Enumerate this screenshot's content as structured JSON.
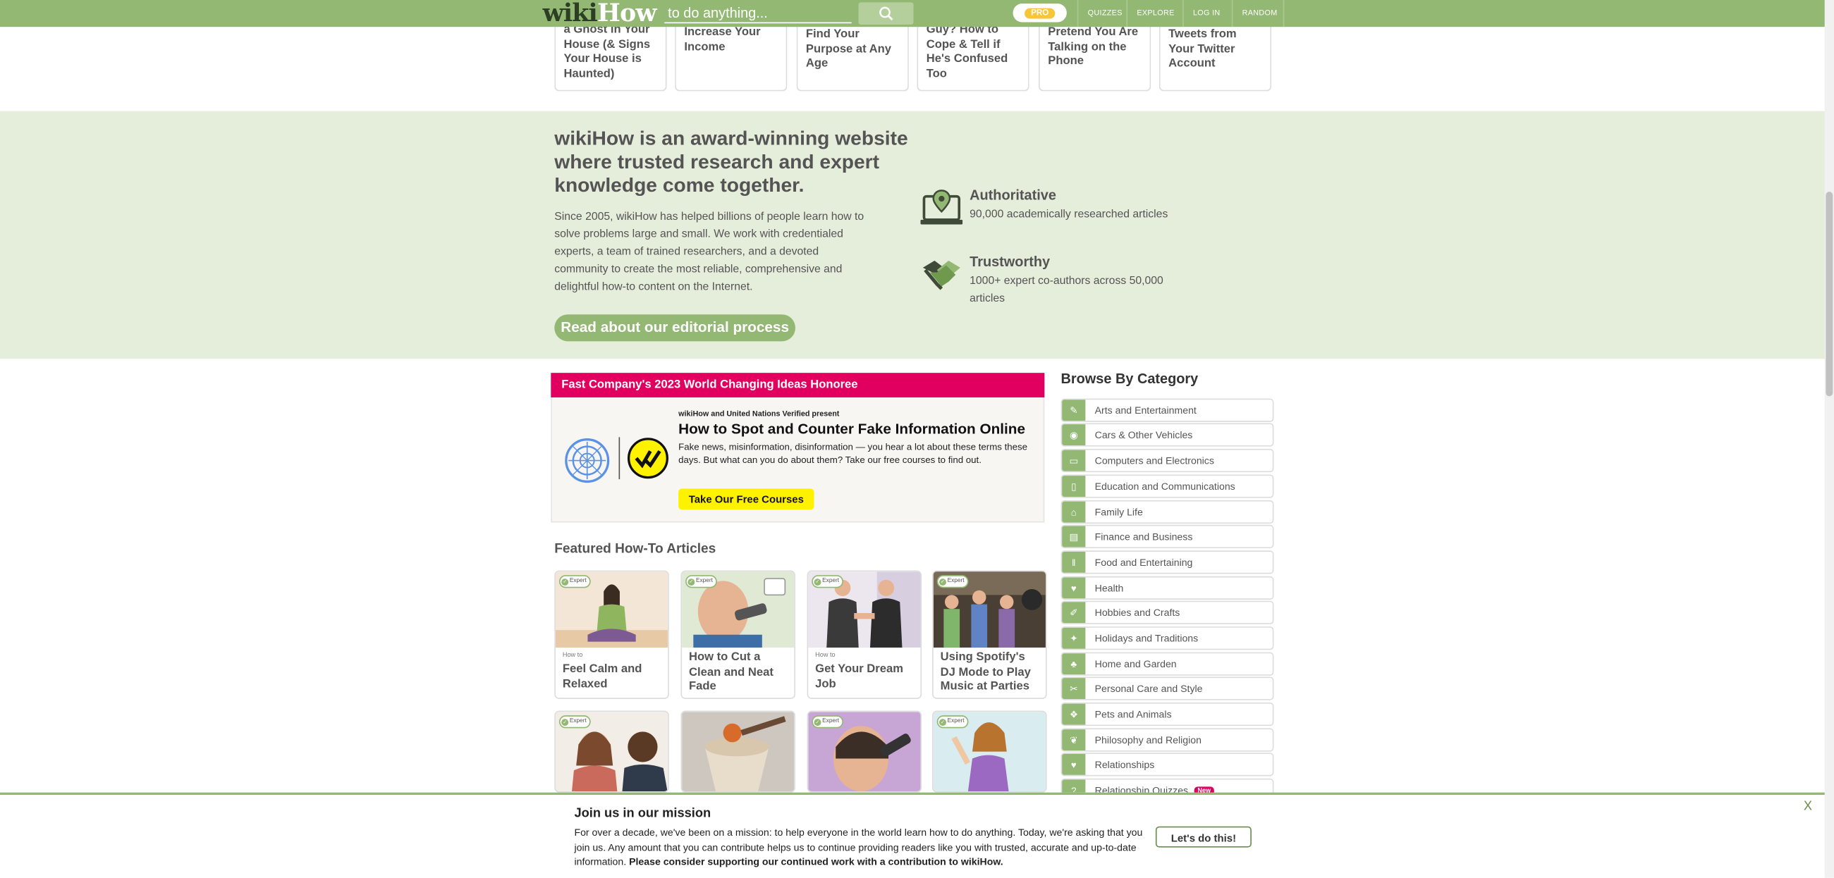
{
  "header": {
    "logo_part1": "wiki",
    "logo_part2": "How",
    "search_placeholder": "to do anything...",
    "pro_label": "PRO",
    "nav": [
      "QUIZZES",
      "EXPLORE",
      "LOG IN",
      "RANDOM"
    ]
  },
  "related_cards": [
    "a Ghost in Your House (& Signs Your House is Haunted)",
    "Increase Your Income",
    "Find Your Purpose at Any Age",
    "Guy? How to Cope & Tell if He's Confused Too",
    "Pretend You Are Talking on the Phone",
    "Tweets from Your Twitter Account"
  ],
  "award": {
    "heading": "wikiHow is an award-winning website where trusted research and expert knowledge come together.",
    "body": "Since 2005, wikiHow has helped billions of people learn how to solve problems large and small. We work with credentialed experts, a team of trained researchers, and a devoted community to create the most reliable, comprehensive and delightful how-to content on the Internet.",
    "button": "Read about our editorial process",
    "features": [
      {
        "title": "Authoritative",
        "desc": "90,000 academically researched articles",
        "icon": "laptop-pin-icon"
      },
      {
        "title": "Trustworthy",
        "desc": "1000+ expert co-authors across 50,000 articles",
        "icon": "handshake-icon"
      }
    ]
  },
  "fast_company": {
    "header": "Fast Company's 2023 World Changing Ideas Honoree",
    "kicker": "wikiHow and United Nations Verified present",
    "title": "How to Spot and Counter Fake Information Online",
    "desc": "Fake news, misinformation, disinformation — you hear a lot about these terms these days. But what can you do about them? Take our free courses to find out.",
    "button": "Take Our Free Courses"
  },
  "featured": {
    "heading": "Featured How-To Articles",
    "badge": "Expert",
    "articles": [
      {
        "howto": "How to",
        "title": "Feel Calm and Relaxed"
      },
      {
        "howto": "",
        "title": "How to Cut a Clean and Neat Fade"
      },
      {
        "howto": "How to",
        "title": "Get Your Dream Job"
      },
      {
        "howto": "",
        "title": "Using Spotify's DJ Mode to Play Music at Parties"
      }
    ]
  },
  "categories": {
    "heading": "Browse By Category",
    "new_label": "New",
    "items": [
      "Arts and Entertainment",
      "Cars & Other Vehicles",
      "Computers and Electronics",
      "Education and Communications",
      "Family Life",
      "Finance and Business",
      "Food and Entertaining",
      "Health",
      "Hobbies and Crafts",
      "Holidays and Traditions",
      "Home and Garden",
      "Personal Care and Style",
      "Pets and Animals",
      "Philosophy and Religion",
      "Relationships",
      "Relationship Quizzes"
    ]
  },
  "banner": {
    "title": "Join us in our mission",
    "text": "For over a decade, we've been on a mission: to help everyone in the world learn how to do anything. Today, we're asking that you join us. Any amount that you can contribute helps us to continue providing readers like you with trusted, accurate and up-to-date information.",
    "bold": "Please consider supporting our continued work with a contribution to wikiHow.",
    "button": "Let's do this!",
    "close": "X"
  },
  "colors": {
    "brand_green": "#93b874",
    "band_bg": "#e5eddb",
    "fast_company_pink": "#e10060",
    "course_button": "#fff200"
  }
}
